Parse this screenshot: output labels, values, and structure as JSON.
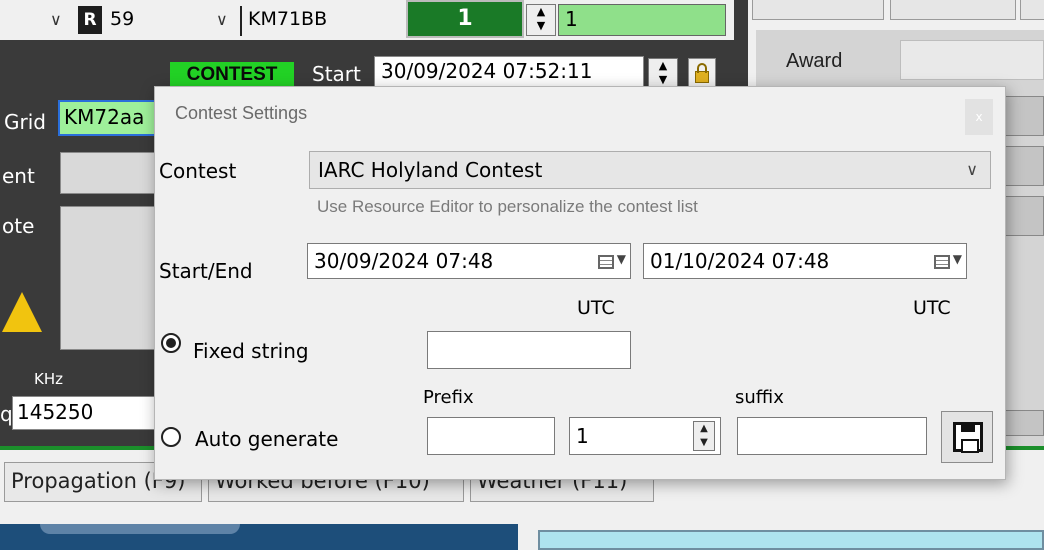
{
  "colors": {
    "contest_badge": "#22d125",
    "grid_field": "#9ef09a",
    "qso_counter": "#1a7a27",
    "counter_field": "#8fe08a",
    "panel_dark": "#3a3a3a"
  },
  "top": {
    "rst_prefix": "R",
    "rst_value": "59",
    "locator_value": "KM71BB",
    "counter_value": "1",
    "counter_field_value": "1"
  },
  "main": {
    "contest_badge": "CONTEST",
    "start_label": "Start",
    "start_value": "30/09/2024 07:52:11",
    "grid_label": "Grid",
    "grid_value": "KM72aa",
    "comment_label": "ent",
    "note_label": "ote",
    "khz_label": "KHz",
    "freq_prefix": "q",
    "freq_value": "145250"
  },
  "right_panel": {
    "award_label": "Award"
  },
  "tabs": [
    {
      "label": "Propagation (F9)"
    },
    {
      "label": "Worked before (F10)"
    },
    {
      "label": "Weather (F11)"
    }
  ],
  "dialog": {
    "title": "Contest Settings",
    "close_label": "x",
    "contest_label": "Contest",
    "contest_value": "IARC Holyland Contest",
    "hint": "Use Resource Editor to personalize the contest list",
    "start_end_label": "Start/End",
    "start_date": "30/09/2024 07:48",
    "end_date": "01/10/2024 07:48",
    "utc_label_1": "UTC",
    "utc_label_2": "UTC",
    "fixed_string_label": "Fixed string",
    "fixed_string_value": "",
    "auto_generate_label": "Auto generate",
    "prefix_label": "Prefix",
    "prefix_value": "",
    "number_value": "1",
    "suffix_label": "suffix",
    "suffix_value": "",
    "selected_mode": "Fixed string"
  }
}
